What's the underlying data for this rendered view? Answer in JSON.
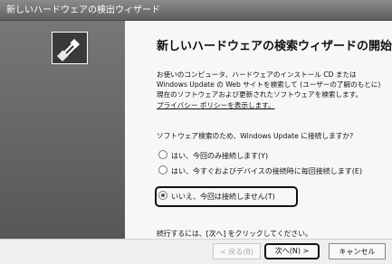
{
  "window": {
    "title": "新しいハードウェアの検出ウィザード"
  },
  "page": {
    "heading": "新しいハードウェアの検索ウィザードの開始",
    "description": "お使いのコンピュータ、ハードウェアのインストール CD または Windows Update の Web サイトを検索して (ユーザーの了解のもとに) 現在のソフトウェアおよび更新されたソフトウェアを検索します。",
    "privacy_link": "プライバシー ポリシーを表示します。",
    "question": "ソフトウェア検索のため、Windows Update に接続しますか?",
    "options": [
      {
        "label": "はい、今回のみ接続します(Y)",
        "selected": false
      },
      {
        "label": "はい、今すぐおよびデバイスの接続時に毎回接続します(E)",
        "selected": false
      },
      {
        "label": "いいえ、今回は接続しません(T)",
        "selected": true
      }
    ],
    "continue_text": "続行するには、[次へ] をクリックしてください。"
  },
  "buttons": {
    "back": "< 戻る(B)",
    "next": "次へ(N) >",
    "cancel": "キャンセル"
  }
}
